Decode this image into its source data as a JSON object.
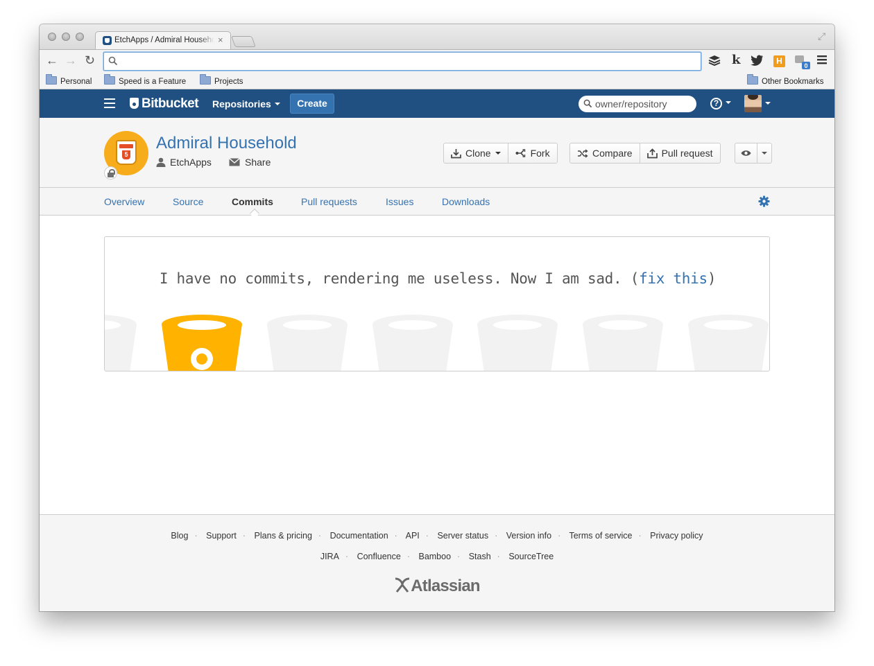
{
  "browser": {
    "tab_title": "EtchApps / Admiral Household",
    "tab_close": "×",
    "address_value": "",
    "bookmarks": [
      "Personal",
      "Speed is a Feature",
      "Projects"
    ],
    "other_bookmarks": "Other Bookmarks",
    "extension_badge": "0"
  },
  "header": {
    "brand": "Bitbucket",
    "repositories_label": "Repositories",
    "create_label": "Create",
    "search_placeholder": "owner/repository",
    "brand_color": "#205081"
  },
  "repo": {
    "name": "Admiral Household",
    "owner": "EtchApps",
    "share_label": "Share",
    "buttons": {
      "clone": "Clone",
      "fork": "Fork",
      "compare": "Compare",
      "pull_request": "Pull request"
    }
  },
  "tabs": [
    {
      "label": "Overview",
      "active": false
    },
    {
      "label": "Source",
      "active": false
    },
    {
      "label": "Commits",
      "active": true
    },
    {
      "label": "Pull requests",
      "active": false
    },
    {
      "label": "Issues",
      "active": false
    },
    {
      "label": "Downloads",
      "active": false
    }
  ],
  "empty_state": {
    "message": "I have no commits, rendering me useless. Now I am sad.",
    "open_paren": "(",
    "link_text": "fix this",
    "close_paren": ")",
    "accent_color": "#ffb300"
  },
  "footer": {
    "links_row1": [
      "Blog",
      "Support",
      "Plans & pricing",
      "Documentation",
      "API",
      "Server status",
      "Version info",
      "Terms of service",
      "Privacy policy"
    ],
    "links_row2": [
      "JIRA",
      "Confluence",
      "Bamboo",
      "Stash",
      "SourceTree"
    ],
    "brand": "Atlassian"
  }
}
